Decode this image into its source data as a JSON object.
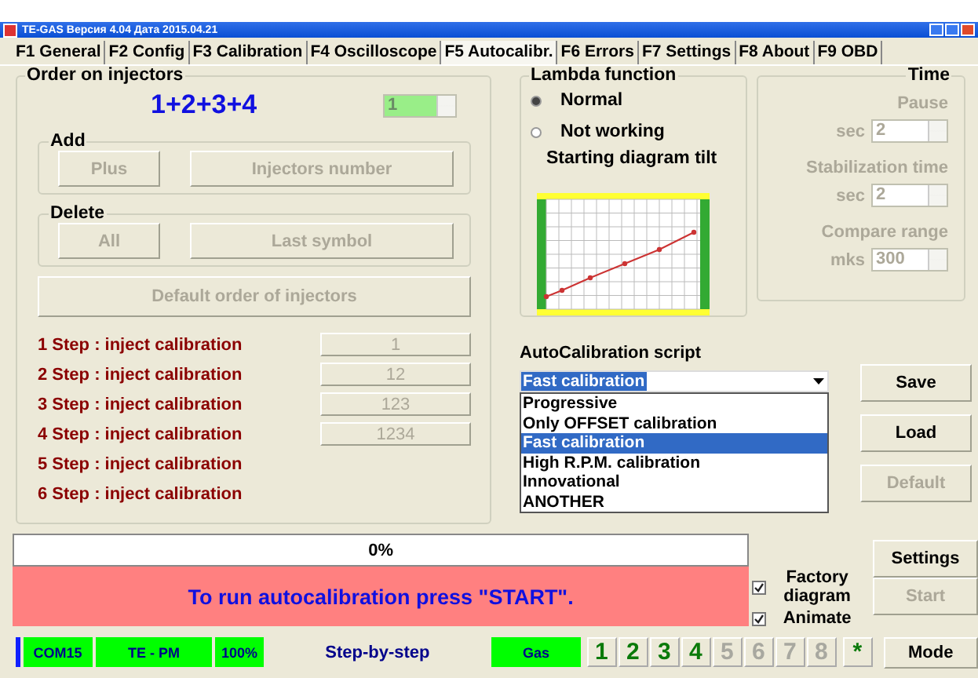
{
  "window": {
    "title": "TE-GAS Версия 4.04  Дата 2015.04.21"
  },
  "tabs": [
    {
      "label": "F1 General",
      "selected": false
    },
    {
      "label": "F2 Config",
      "selected": false
    },
    {
      "label": "F3 Calibration",
      "selected": false
    },
    {
      "label": "F4 Oscilloscope",
      "selected": false
    },
    {
      "label": "F5 Autocalibr.",
      "selected": true
    },
    {
      "label": "F6 Errors",
      "selected": false
    },
    {
      "label": "F7 Settings",
      "selected": false
    },
    {
      "label": "F8 About",
      "selected": false
    },
    {
      "label": "F9 OBD",
      "selected": false
    }
  ],
  "injectors": {
    "title": "Order on injectors",
    "order": "1+2+3+4",
    "counter": {
      "value": "1",
      "disabled": true
    },
    "add": {
      "title": "Add",
      "buttons": [
        {
          "label": "Plus",
          "disabled": true
        },
        {
          "label": "Injectors number",
          "disabled": true
        }
      ]
    },
    "delete": {
      "title": "Delete",
      "buttons": [
        {
          "label": "All",
          "disabled": true
        },
        {
          "label": "Last symbol",
          "disabled": true
        }
      ]
    },
    "default_button": {
      "label": "Default order of injectors",
      "disabled": true
    },
    "steps": [
      {
        "label": "1 Step : inject calibration",
        "value": "1"
      },
      {
        "label": "2 Step : inject calibration",
        "value": "12"
      },
      {
        "label": "3 Step : inject calibration",
        "value": "123"
      },
      {
        "label": "4 Step : inject calibration",
        "value": "1234"
      },
      {
        "label": "5 Step : inject calibration"
      },
      {
        "label": "6 Step : inject calibration"
      }
    ]
  },
  "lambda": {
    "title": "Lambda function",
    "options": [
      {
        "label": "Normal",
        "selected": true
      },
      {
        "label": "Not working",
        "selected": false
      }
    ],
    "tilt_title": "Starting diagram tilt"
  },
  "time": {
    "title": "Time",
    "disabled": true,
    "fields": [
      {
        "label": "Pause",
        "unit": "sec",
        "value": "2"
      },
      {
        "label": "Stabilization time",
        "unit": "sec",
        "value": "2"
      },
      {
        "label": "Compare range",
        "unit": "mks",
        "value": "300"
      }
    ]
  },
  "script": {
    "title": "AutoCalibration script",
    "value": "Fast calibration",
    "options": [
      {
        "label": "Progressive",
        "selected": false
      },
      {
        "label": "Only OFFSET calibration",
        "selected": false
      },
      {
        "label": "Fast calibration",
        "selected": true
      },
      {
        "label": "High R.P.M. calibration",
        "selected": false
      },
      {
        "label": "Innovational",
        "selected": false
      },
      {
        "label": "ANOTHER",
        "selected": false
      }
    ]
  },
  "side_buttons": [
    {
      "label": "Save",
      "disabled": false
    },
    {
      "label": "Load",
      "disabled": false
    },
    {
      "label": "Default",
      "disabled": true
    }
  ],
  "progress": {
    "text": "0%",
    "level": 0
  },
  "message": "To run autocalibration press \"START\".",
  "checks": [
    {
      "label": "Factory diagram",
      "checked": true
    },
    {
      "label": "Animate",
      "checked": true
    }
  ],
  "actions": [
    {
      "label": "Settings",
      "disabled": false
    },
    {
      "label": "Start",
      "disabled": true
    }
  ],
  "status": [
    {
      "text": "COM15",
      "color": "#00ff00"
    },
    {
      "text": "TE - PM",
      "color": "#00ff00"
    },
    {
      "text": "100%",
      "color": "#00ff00"
    },
    {
      "text": "Step-by-step",
      "color": "#ece9d8"
    },
    {
      "text": "Gas",
      "color": "#00ff00"
    }
  ],
  "cylinders": [
    {
      "label": "1",
      "active": true
    },
    {
      "label": "2",
      "active": true
    },
    {
      "label": "3",
      "active": true
    },
    {
      "label": "4",
      "active": true
    },
    {
      "label": "5",
      "active": false
    },
    {
      "label": "6",
      "active": false
    },
    {
      "label": "7",
      "active": false
    },
    {
      "label": "8",
      "active": false
    }
  ],
  "all_cylinders": "*",
  "mode_button": "Mode"
}
